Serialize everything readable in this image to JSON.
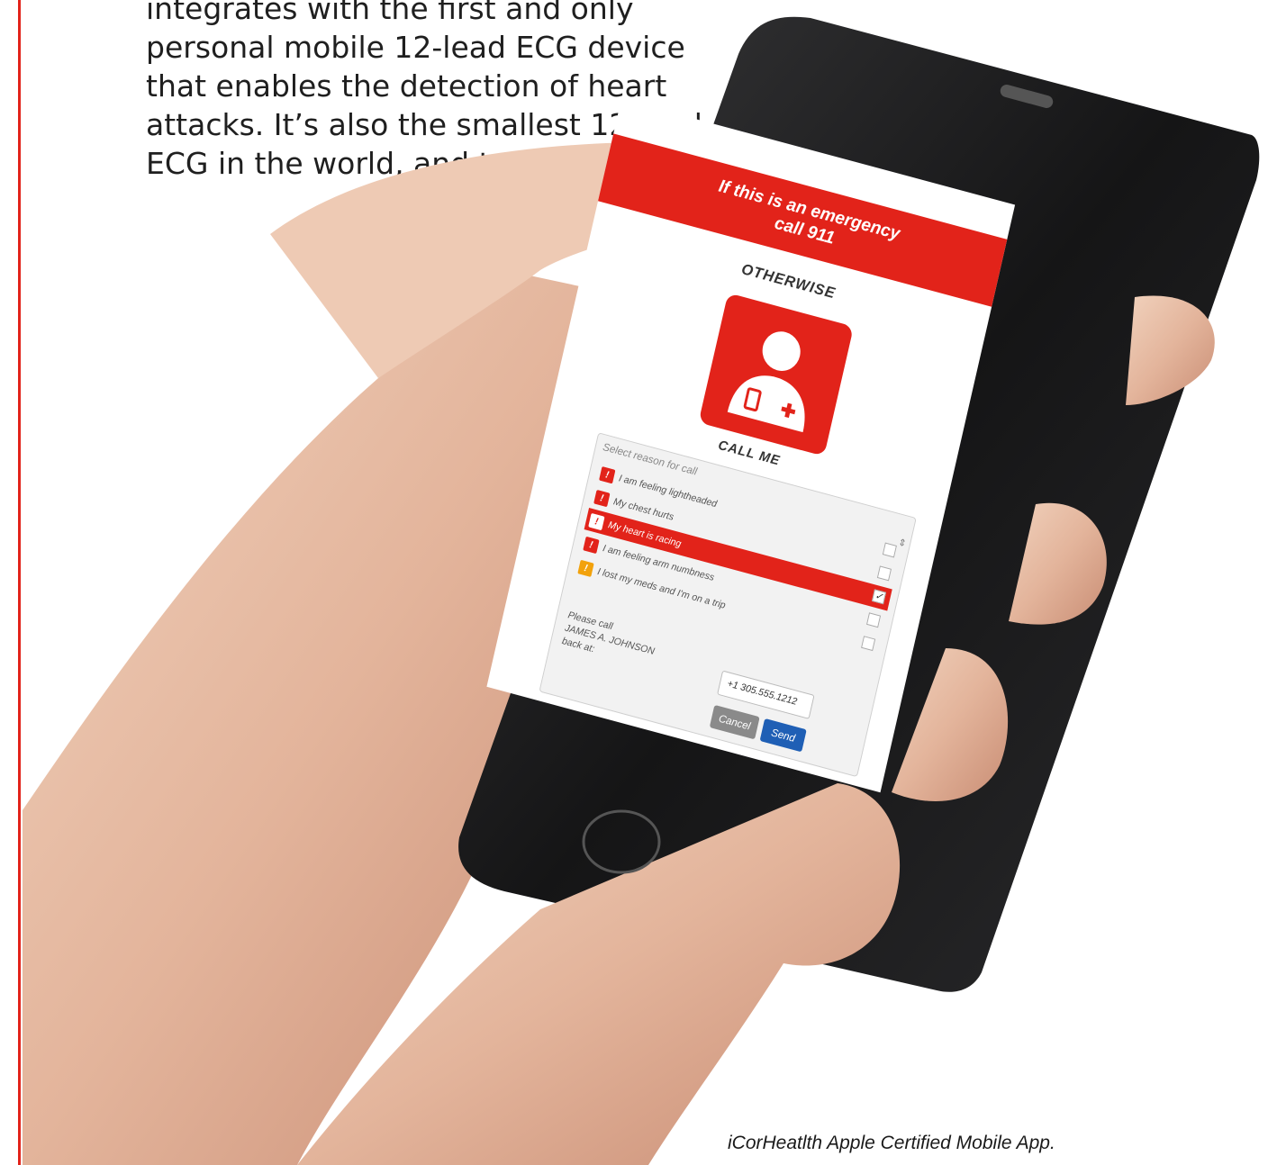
{
  "article": {
    "lines": [
      "integrates with the first and only",
      "personal mobile 12-lead ECG device",
      "that enables the detection of heart",
      "attacks. It’s also the smallest 12-lead",
      "ECG in the world, and together with"
    ],
    "caption": "iCorHeatlth Apple Certified Mobile App."
  },
  "app_screen": {
    "banner_line1": "If this is an emergency",
    "banner_line2": "call 911",
    "otherwise": "OTHERWISE",
    "call_me": "CALL ME",
    "select_placeholder": "Select reason for call",
    "reasons": [
      {
        "label": "I am feeling lightheaded",
        "checked": false
      },
      {
        "label": "My chest hurts",
        "checked": false
      },
      {
        "label": "My heart is racing",
        "checked": true
      },
      {
        "label": "I am feeling arm numbness",
        "checked": false
      },
      {
        "label": "I lost my meds and I'm on a trip",
        "checked": false
      }
    ],
    "callback_line1": "Please call",
    "callback_line2": "JAMES A. JOHNSON",
    "callback_line3": "back at:",
    "phone_value": "+1 305.555.1212",
    "cancel_label": "Cancel",
    "send_label": "Send"
  },
  "colors": {
    "accent_red": "#e2231a",
    "send_blue": "#1f5fb5",
    "warning_amber": "#f2a20c"
  }
}
